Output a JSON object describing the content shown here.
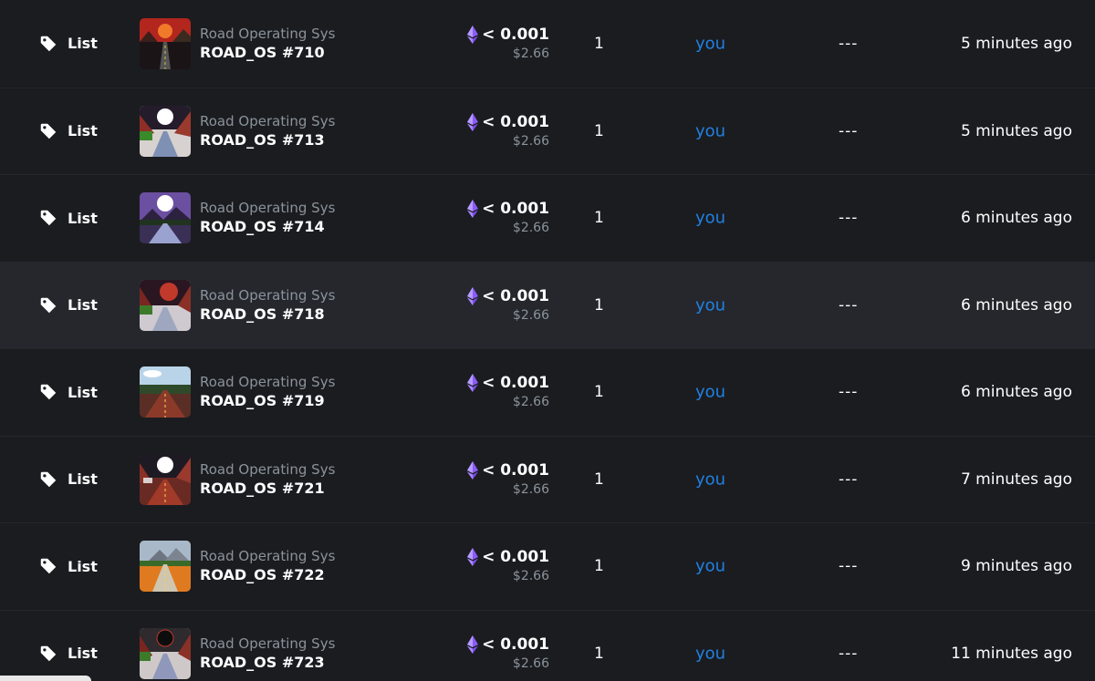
{
  "colors": {
    "background": "#1b1c20",
    "row_highlight": "#25272d",
    "link_blue": "#2081e2",
    "muted_text": "#8a939b",
    "eth_purple": "#8a5cf6"
  },
  "icons": {
    "event": "tag-icon",
    "currency": "ethereum-icon"
  },
  "activity": [
    {
      "event": "List",
      "collection": "Road Operating Sys",
      "token": "ROAD_OS #710",
      "price": "< 0.001",
      "price_usd": "$2.66",
      "quantity": "1",
      "from": "you",
      "to": "---",
      "time": "5 minutes ago",
      "thumb": "red-sky-road"
    },
    {
      "event": "List",
      "collection": "Road Operating Sys",
      "token": "ROAD_OS #713",
      "price": "< 0.001",
      "price_usd": "$2.66",
      "quantity": "1",
      "from": "you",
      "to": "---",
      "time": "5 minutes ago",
      "thumb": "moon-canyon-road"
    },
    {
      "event": "List",
      "collection": "Road Operating Sys",
      "token": "ROAD_OS #714",
      "price": "< 0.001",
      "price_usd": "$2.66",
      "quantity": "1",
      "from": "you",
      "to": "---",
      "time": "6 minutes ago",
      "thumb": "purple-moon-road"
    },
    {
      "event": "List",
      "collection": "Road Operating Sys",
      "token": "ROAD_OS #718",
      "price": "< 0.001",
      "price_usd": "$2.66",
      "quantity": "1",
      "from": "you",
      "to": "---",
      "time": "6 minutes ago",
      "thumb": "red-moon-canyon"
    },
    {
      "event": "List",
      "collection": "Road Operating Sys",
      "token": "ROAD_OS #719",
      "price": "< 0.001",
      "price_usd": "$2.66",
      "quantity": "1",
      "from": "you",
      "to": "---",
      "time": "6 minutes ago",
      "thumb": "forest-road"
    },
    {
      "event": "List",
      "collection": "Road Operating Sys",
      "token": "ROAD_OS #721",
      "price": "< 0.001",
      "price_usd": "$2.66",
      "quantity": "1",
      "from": "you",
      "to": "---",
      "time": "7 minutes ago",
      "thumb": "night-moon-desert"
    },
    {
      "event": "List",
      "collection": "Road Operating Sys",
      "token": "ROAD_OS #722",
      "price": "< 0.001",
      "price_usd": "$2.66",
      "quantity": "1",
      "from": "you",
      "to": "---",
      "time": "9 minutes ago",
      "thumb": "autumn-mountain-road"
    },
    {
      "event": "List",
      "collection": "Road Operating Sys",
      "token": "ROAD_OS #723",
      "price": "< 0.001",
      "price_usd": "$2.66",
      "quantity": "1",
      "from": "you",
      "to": "---",
      "time": "11 minutes ago",
      "thumb": "eclipse-canyon-road"
    }
  ]
}
